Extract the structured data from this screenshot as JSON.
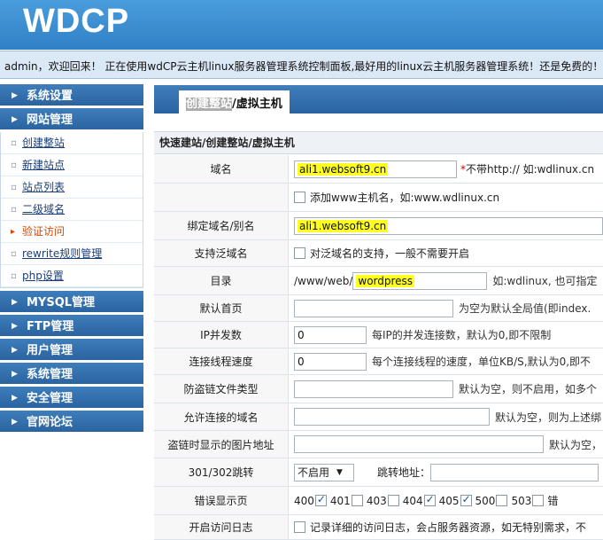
{
  "header": {
    "logo": "WDCP"
  },
  "welcome": {
    "text": "admin，欢迎回来！ 正在使用wdCP云主机linux服务器管理系统控制面板,最好用的linux云主机服务器管理系统！还是免费的！"
  },
  "sidebar": {
    "sections": [
      {
        "label": "系统设置"
      },
      {
        "label": "网站管理"
      },
      {
        "label": "MYSQL管理"
      },
      {
        "label": "FTP管理"
      },
      {
        "label": "用户管理"
      },
      {
        "label": "系统管理"
      },
      {
        "label": "安全管理"
      },
      {
        "label": "官网论坛"
      }
    ],
    "site_items": [
      {
        "label": "创建整站"
      },
      {
        "label": "新建站点"
      },
      {
        "label": "站点列表"
      },
      {
        "label": "二级域名"
      },
      {
        "label": "验证访问"
      },
      {
        "label": "rewrite规则管理"
      },
      {
        "label": "php设置"
      }
    ]
  },
  "tab": {
    "highlighted": "创建整站",
    "rest": "/虚拟主机"
  },
  "form": {
    "title": "快速建站/创建整站/虚拟主机",
    "domain": {
      "label": "域名",
      "value": "ali1.websoft9.cn",
      "required_mark": "*",
      "note": "不带http:// 如:wdlinux.cn"
    },
    "add_www": {
      "text": "添加www主机名，如:www.wdlinux.cn"
    },
    "alias": {
      "label": "绑定域名/别名",
      "value": "ali1.websoft9.cn"
    },
    "wildcard": {
      "label": "支持泛域名",
      "text": "对泛域名的支持，一般不需要开启"
    },
    "directory": {
      "label": "目录",
      "prefix": "/www/web/",
      "value": "wordpress",
      "note": "如:wdlinux, 也可指定"
    },
    "default_page": {
      "label": "默认首页",
      "value": "",
      "note": "为空为默认全局值(即index."
    },
    "ip_concurrency": {
      "label": "IP并发数",
      "value": "0",
      "note": "每IP的并发连接数，默认为0,即不限制"
    },
    "thread_speed": {
      "label": "连接线程速度",
      "value": "0",
      "note": "每个连接线程的速度，单位KB/S,默认为0,即不"
    },
    "hotlink_types": {
      "label": "防盗链文件类型",
      "value": "",
      "note": "默认为空，则不启用，如多个"
    },
    "allowed_domains": {
      "label": "允许连接的域名",
      "value": "",
      "note": "默认为空，则为上述绑"
    },
    "hotlink_image": {
      "label": "盗链时显示的图片地址",
      "value": "",
      "note": "默认为空，"
    },
    "redirect": {
      "label": "301/302跳转",
      "select": "不启用",
      "addr_label": "跳转地址：",
      "addr_value": ""
    },
    "error_pages": {
      "label": "错误显示页",
      "codes": [
        "400",
        "401",
        "403",
        "404",
        "405",
        "500",
        "503",
        "错"
      ],
      "checked": [
        true,
        false,
        false,
        true,
        true,
        false,
        false,
        true
      ]
    },
    "access_log": {
      "label": "开启访问日志",
      "text": "记录详细的访问日志，会占服务器资源，如无特别需求，不"
    }
  }
}
